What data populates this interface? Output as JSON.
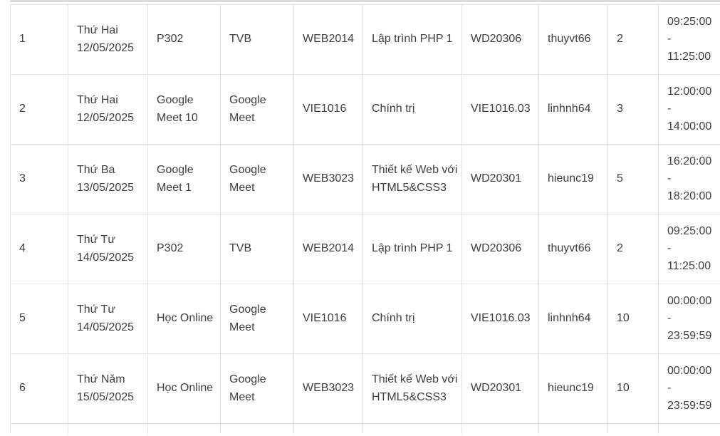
{
  "schedule": {
    "rows": [
      {
        "stt": "1",
        "day": "Thứ Hai",
        "date": "12/05/2025",
        "room": "P302",
        "location": "TVB",
        "subject_code": "WEB2014",
        "subject_name": "Lập trình PHP 1",
        "class_code": "WD20306",
        "lecturer": "thuyvt66",
        "shift": "2",
        "time_start": "09:25:00",
        "time_sep": "-",
        "time_end": "11:25:00"
      },
      {
        "stt": "2",
        "day": "Thứ Hai",
        "date": "12/05/2025",
        "room": "Google Meet 10",
        "location": "Google Meet",
        "subject_code": "VIE1016",
        "subject_name": "Chính trị",
        "class_code": "VIE1016.03",
        "lecturer": "linhnh64",
        "shift": "3",
        "time_start": "12:00:00",
        "time_sep": "-",
        "time_end": "14:00:00"
      },
      {
        "stt": "3",
        "day": "Thứ Ba",
        "date": "13/05/2025",
        "room": "Google Meet 1",
        "location": "Google Meet",
        "subject_code": "WEB3023",
        "subject_name": "Thiết kế Web với HTML5&CSS3",
        "class_code": "WD20301",
        "lecturer": "hieunc19",
        "shift": "5",
        "time_start": "16:20:00",
        "time_sep": "-",
        "time_end": "18:20:00"
      },
      {
        "stt": "4",
        "day": "Thứ Tư",
        "date": "14/05/2025",
        "room": "P302",
        "location": "TVB",
        "subject_code": "WEB2014",
        "subject_name": "Lập trình PHP 1",
        "class_code": "WD20306",
        "lecturer": "thuyvt66",
        "shift": "2",
        "time_start": "09:25:00",
        "time_sep": "-",
        "time_end": "11:25:00"
      },
      {
        "stt": "5",
        "day": "Thứ Tư",
        "date": "14/05/2025",
        "room": "Học Online",
        "location": "Google Meet",
        "subject_code": "VIE1016",
        "subject_name": "Chính trị",
        "class_code": "VIE1016.03",
        "lecturer": "linhnh64",
        "shift": "10",
        "time_start": "00:00:00",
        "time_sep": "-",
        "time_end": "23:59:59"
      },
      {
        "stt": "6",
        "day": "Thứ Năm",
        "date": "15/05/2025",
        "room": "Học Online",
        "location": "Google Meet",
        "subject_code": "WEB3023",
        "subject_name": "Thiết kế Web với HTML5&CSS3",
        "class_code": "WD20301",
        "lecturer": "hieunc19",
        "shift": "10",
        "time_start": "00:00:00",
        "time_sep": "-",
        "time_end": "23:59:59"
      }
    ]
  },
  "colors": {
    "text": "#3e3e3e",
    "border": "#e3e3e3",
    "background": "#ffffff"
  }
}
